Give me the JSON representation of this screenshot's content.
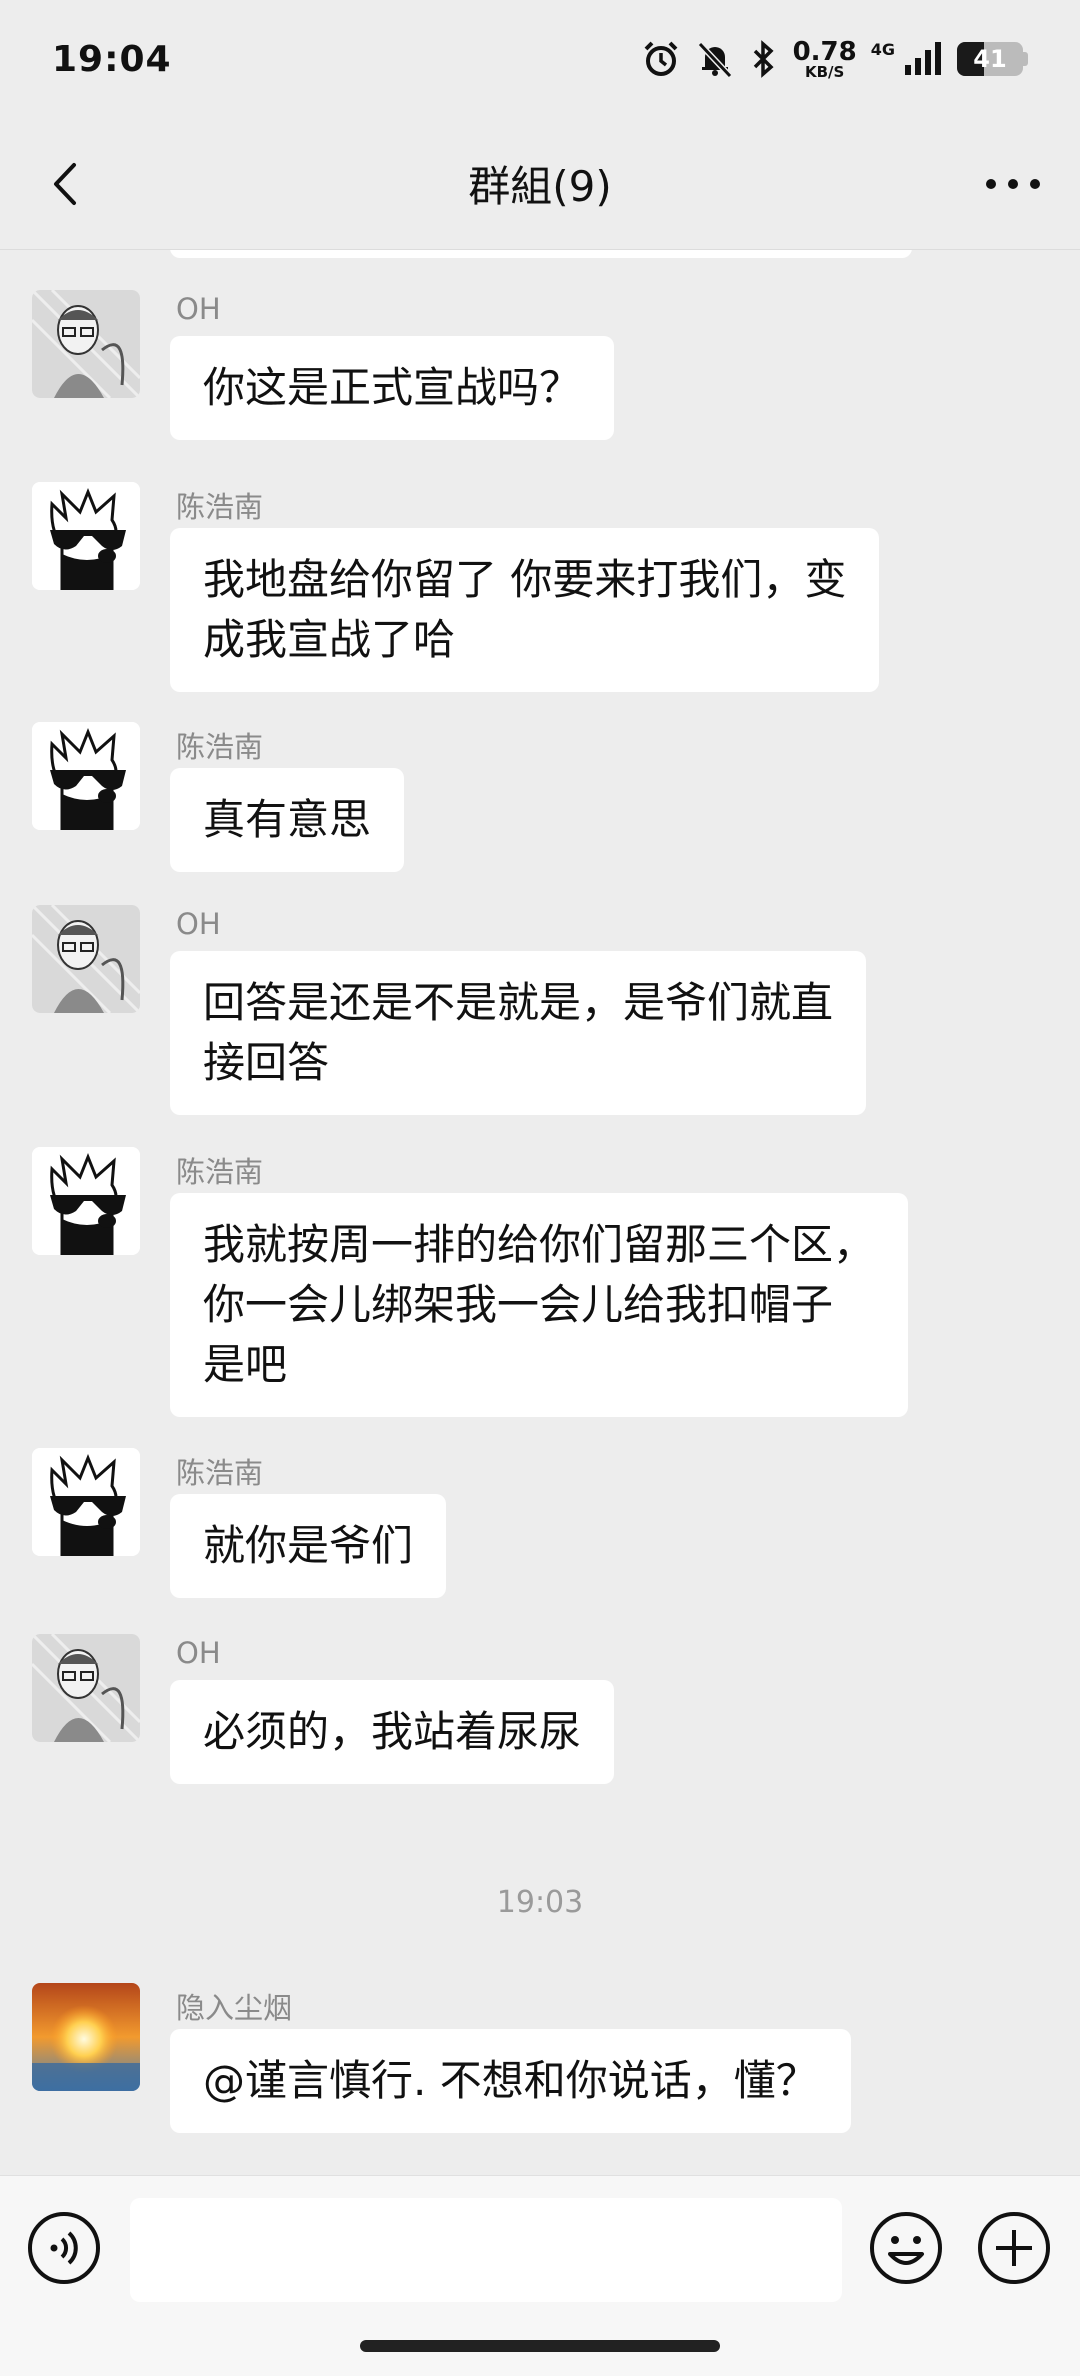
{
  "status_bar": {
    "time": "19:04",
    "net_speed_value": "0.78",
    "net_speed_unit": "KB/S",
    "network_type": "4G",
    "battery_level": "41",
    "battery_fraction": 0.41,
    "icons": [
      "alarm-icon",
      "mute-bell-icon",
      "bluetooth-icon",
      "signal-icon",
      "battery-icon"
    ]
  },
  "nav": {
    "back_icon": "chevron-left-icon",
    "title": "群組(9)",
    "more_icon": "more-dots-icon"
  },
  "messages": [
    {
      "sender": "OH",
      "avatar": "sketch-portrait",
      "lines": [
        "你这是正式宣战吗？"
      ]
    },
    {
      "sender": "陈浩南",
      "avatar": "sunglasses-bear",
      "lines": [
        "我地盘给你留了 你要来打我们，变",
        "成我宣战了哈"
      ]
    },
    {
      "sender": "陈浩南",
      "avatar": "sunglasses-bear",
      "lines": [
        "真有意思"
      ]
    },
    {
      "sender": "OH",
      "avatar": "sketch-portrait",
      "lines": [
        "回答是还是不是就是，是爷们就直",
        "接回答"
      ]
    },
    {
      "sender": "陈浩南",
      "avatar": "sunglasses-bear",
      "lines": [
        "我就按周一排的给你们留那三个区，",
        "你一会儿绑架我一会儿给我扣帽子",
        "是吧"
      ]
    },
    {
      "sender": "陈浩南",
      "avatar": "sunglasses-bear",
      "lines": [
        "就你是爷们"
      ]
    },
    {
      "sender": "OH",
      "avatar": "sketch-portrait",
      "lines": [
        "必须的，我站着尿尿"
      ]
    },
    {
      "sender": "隐入尘烟",
      "avatar": "sunset",
      "lines": [
        "@谨言慎行. 不想和你说话，懂？"
      ]
    }
  ],
  "timestamp": "19:03",
  "input_bar": {
    "voice_icon": "voice-icon",
    "text_value": "",
    "emoji_icon": "emoji-icon",
    "plus_icon": "plus-icon"
  },
  "colors": {
    "background": "#ededed",
    "bubble": "#ffffff",
    "sender_text": "#8a8a8a"
  }
}
